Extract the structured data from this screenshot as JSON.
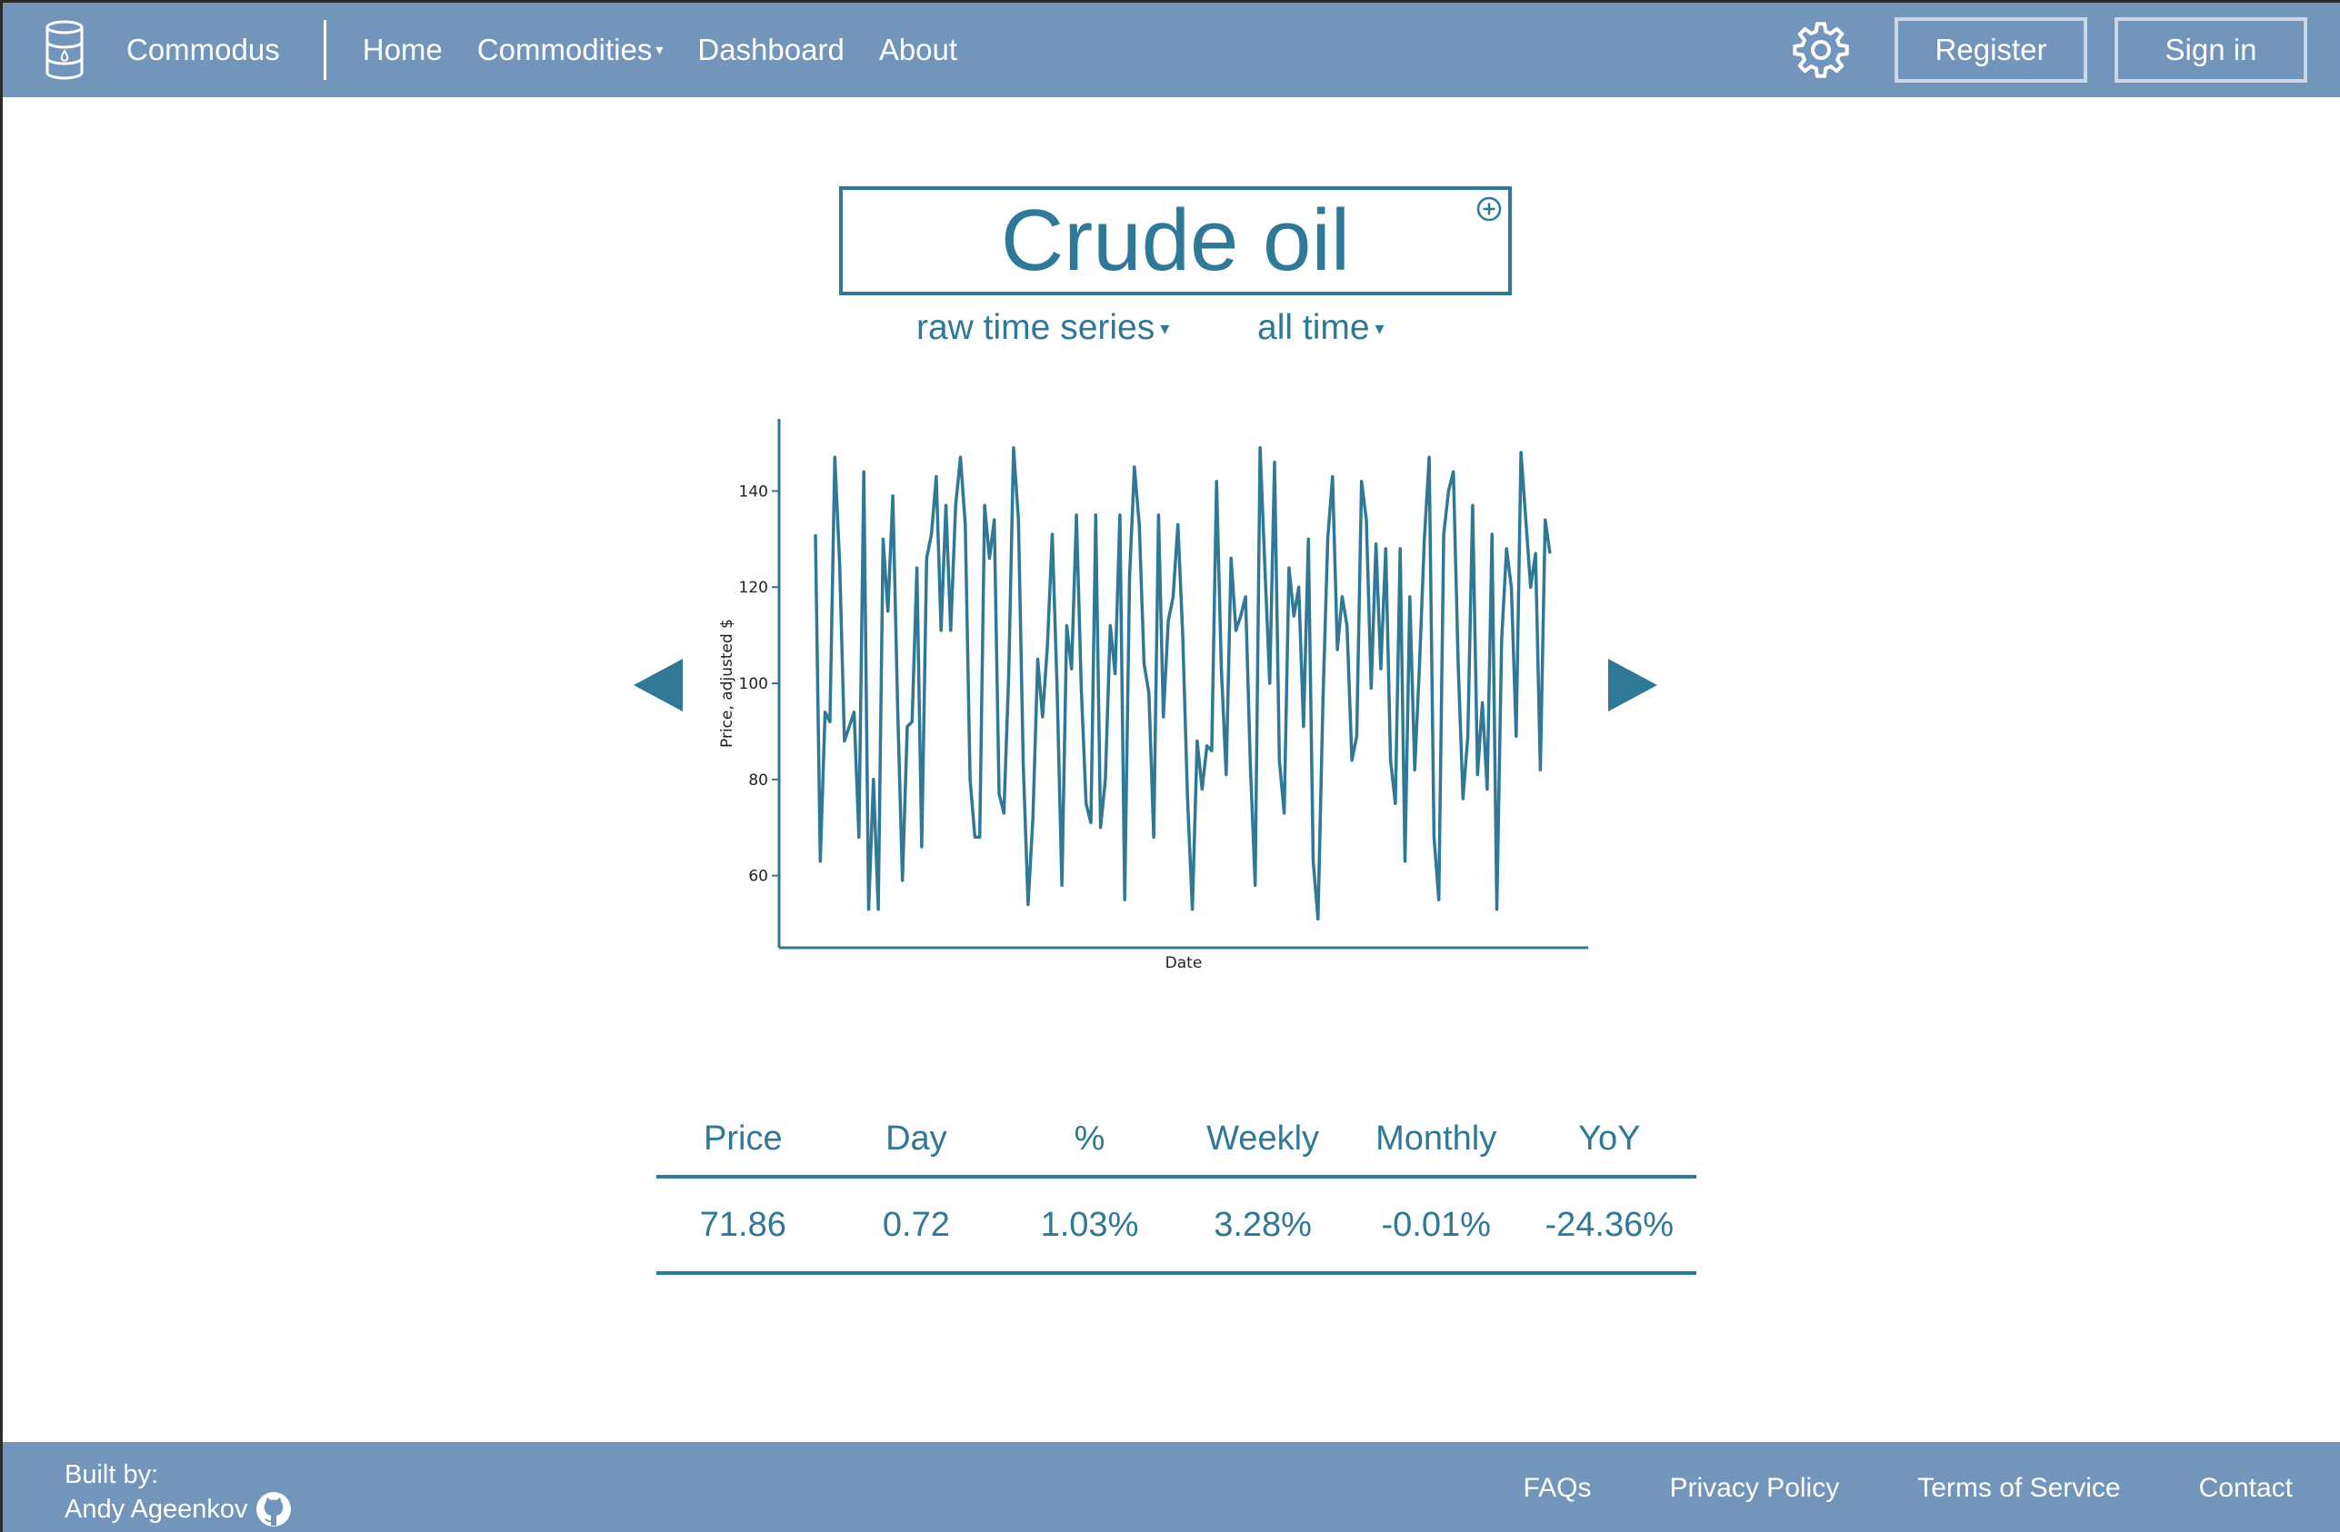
{
  "brand": {
    "name": "Commodus",
    "icon": "oil-barrel-icon"
  },
  "nav": {
    "links": [
      "Home",
      "Commodities",
      "Dashboard",
      "About"
    ],
    "caret": "▾",
    "settings_icon": "gear-icon",
    "register_label": "Register",
    "signin_label": "Sign in"
  },
  "commodity": {
    "title": "Crude oil",
    "add_icon": "plus-circle-icon",
    "series_mode": "raw time series",
    "time_range": "all time"
  },
  "chart_data": {
    "type": "line",
    "xlabel": "Date",
    "ylabel": "Price, adjusted $",
    "ylim": [
      45,
      155
    ],
    "yticks": [
      60,
      80,
      100,
      120,
      140
    ],
    "grid": false,
    "color": "#2f7896",
    "series": [
      {
        "values": [
          131,
          63,
          94,
          92,
          147,
          125,
          88,
          91,
          94,
          68,
          144,
          53,
          80,
          53,
          130,
          115,
          139,
          95,
          59,
          91,
          92,
          124,
          66,
          126,
          131,
          143,
          111,
          137,
          111,
          137,
          147,
          133,
          80,
          68,
          68,
          137,
          126,
          134,
          77,
          73,
          102,
          149,
          134,
          83,
          54,
          72,
          105,
          93,
          108,
          131,
          99,
          58,
          112,
          103,
          135,
          99,
          75,
          71,
          135,
          70,
          80,
          112,
          102,
          135,
          55,
          122,
          145,
          133,
          104,
          98,
          68,
          135,
          93,
          113,
          118,
          133,
          110,
          76,
          53,
          88,
          78,
          87,
          86,
          142,
          103,
          81,
          126,
          111,
          114,
          118,
          83,
          58,
          149,
          124,
          100,
          146,
          84,
          73,
          124,
          114,
          120,
          91,
          130,
          63,
          51,
          96,
          130,
          143,
          107,
          118,
          112,
          84,
          89,
          142,
          134,
          99,
          129,
          103,
          128,
          84,
          75,
          128,
          63,
          118,
          82,
          104,
          130,
          147,
          68,
          55,
          131,
          140,
          144,
          104,
          76,
          89,
          137,
          81,
          96,
          78,
          131,
          53,
          109,
          128,
          120,
          89,
          148,
          134,
          120,
          127,
          82,
          134,
          127
        ]
      }
    ]
  },
  "stats": {
    "headers": [
      "Price",
      "Day",
      "%",
      "Weekly",
      "Monthly",
      "YoY"
    ],
    "values": [
      "71.86",
      "0.72",
      "1.03%",
      "3.28%",
      "-0.01%",
      "-24.36%"
    ]
  },
  "footer": {
    "built_by": "Built by:",
    "author": "Andy Ageenkov",
    "github_icon": "github-icon",
    "links": [
      "FAQs",
      "Privacy Policy",
      "Terms of Service",
      "Contact"
    ]
  },
  "colors": {
    "navbar": "#7395bc",
    "accent": "#2f7896",
    "background": "#ffffff"
  }
}
